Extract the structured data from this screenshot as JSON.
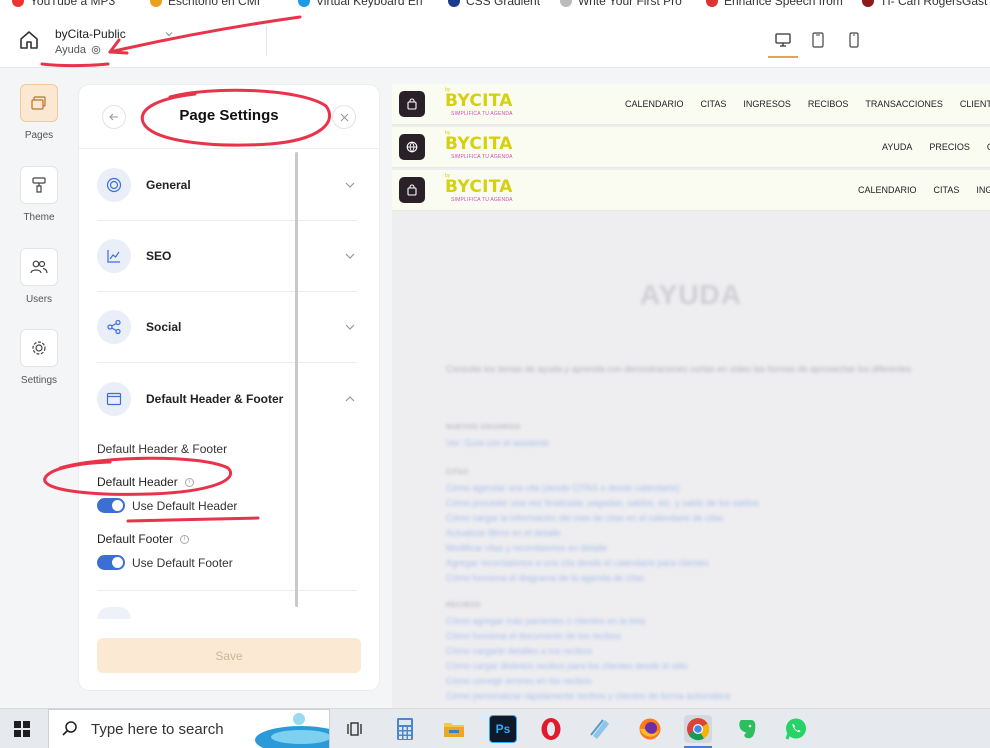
{
  "browser_bookmarks": [
    "YouTube a MP3",
    "Escritorio en CMI",
    "Virtual Keyboard En",
    "CSS Gradient",
    "Write Your First Pro",
    "Enhance Speech from",
    "TI- Can Rogers",
    "Gast"
  ],
  "topbar": {
    "site_name": "byCita-Public",
    "current_page": "Ayuda",
    "devices": [
      "desktop-icon",
      "tablet-icon",
      "mobile-icon"
    ],
    "active_device": "desktop"
  },
  "rail": {
    "items": [
      {
        "label": "Pages",
        "icon": "pages-icon",
        "active": true
      },
      {
        "label": "Theme",
        "icon": "paint-roller-icon",
        "active": false
      },
      {
        "label": "Users",
        "icon": "users-icon",
        "active": false
      },
      {
        "label": "Settings",
        "icon": "gear-icon",
        "active": false
      }
    ]
  },
  "panel": {
    "title": "Page Settings",
    "sections": [
      {
        "label": "General",
        "icon": "general-icon",
        "expanded": false
      },
      {
        "label": "SEO",
        "icon": "chart-icon",
        "expanded": false
      },
      {
        "label": "Social",
        "icon": "share-icon",
        "expanded": false
      },
      {
        "label": "Default Header & Footer",
        "icon": "layout-icon",
        "expanded": true
      }
    ],
    "header_footer": {
      "subtitle": "Default Header & Footer",
      "header_label": "Default Header",
      "header_toggle": "Use Default Header",
      "header_enabled": true,
      "footer_label": "Default Footer",
      "footer_toggle": "Use Default Footer",
      "footer_enabled": true
    },
    "save_label": "Save"
  },
  "preview": {
    "logo_text": "BYCITA",
    "logo_prefix": "by",
    "logo_tagline": "SIMPLIFICA TU AGENDA",
    "header_rows": [
      {
        "badge_icon": "bag-icon",
        "nav": [
          "CALENDARIO",
          "CITAS",
          "INGRESOS",
          "RECIBOS",
          "TRANSACCIONES",
          "CLIENT"
        ]
      },
      {
        "badge_icon": "globe-icon",
        "nav": [
          "AYUDA",
          "PRECIOS",
          "C"
        ]
      },
      {
        "badge_icon": "bag-icon",
        "nav": [
          "CALENDARIO",
          "CITAS",
          "ING"
        ]
      }
    ],
    "page_title": "AYUDA",
    "intro": "Consulte los temas de ayuda y aprenda con demostraciones cortas en video las formas de aprovechar los diferentes",
    "sections": [
      {
        "heading": "NUEVOS USUARIOS",
        "links": [
          "Ver: Guía con el asistente"
        ]
      },
      {
        "heading": "CITAS",
        "links": [
          "Cómo agendar una cita (desde CITAS o desde calendario)",
          "Cómo proceder una vez finalizada: pagadas, saldos, etc. y saldo de los saldos",
          "Cómo cargar la información del mes de citas en el calendario de citas",
          "Actualizar filtros en el detalle",
          "Modificar citas y recordatorios en detalle",
          "Agregar recordatorios a una cita desde el calendario para clientes",
          "Cómo funciona el diagrama de la agenda de citas"
        ]
      },
      {
        "heading": "RECIBOS",
        "links": [
          "Cómo agregar más pacientes o clientes en la lista",
          "Cómo funciona el documento de los recibos",
          "Cómo cargarle detalles a tus recibos",
          "Cómo cargar distintos recibos para los clientes desde el sitio",
          "Cómo corregir errores en los recibos",
          "Cómo personalizar rápidamente recibos y clientes de forma automática"
        ]
      }
    ]
  },
  "taskbar": {
    "search_placeholder": "Type here to search",
    "apps": [
      "task-view-icon",
      "calculator-icon",
      "file-explorer-icon",
      "photoshop-icon",
      "opera-icon",
      "notes-icon",
      "firefox-icon",
      "chrome-icon",
      "evernote-icon",
      "whatsapp-icon"
    ],
    "photoshop_label": "Ps"
  },
  "colors": {
    "accent": "#e8a24b",
    "toggle": "#3b6fd4",
    "annotation": "#e8334a",
    "logo_yellow": "#d6d10f",
    "logo_pink": "#d04cb0"
  }
}
